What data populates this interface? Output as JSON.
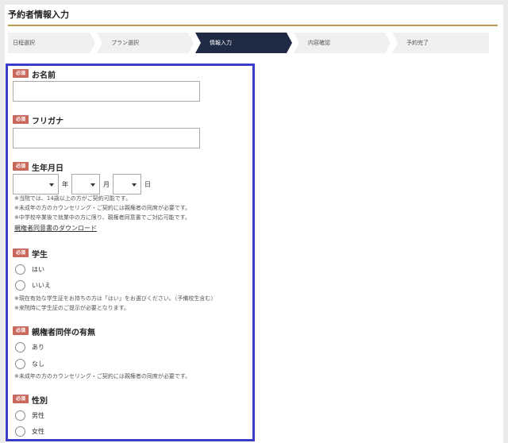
{
  "page": {
    "title": "予約者情報入力"
  },
  "steps": [
    {
      "label": "日程選択"
    },
    {
      "label": "プラン選択"
    },
    {
      "label": "情報入力"
    },
    {
      "label": "内容確認"
    },
    {
      "label": "予約完了"
    }
  ],
  "form": {
    "required_badge": "必須",
    "name": {
      "label": "お名前",
      "value": ""
    },
    "furigana": {
      "label": "フリガナ",
      "value": ""
    },
    "birth": {
      "label": "生年月日",
      "year_unit": "年",
      "month_unit": "月",
      "day_unit": "日",
      "year_value": "",
      "month_value": "",
      "day_value": "",
      "notes": [
        "※当院では、14歳以上の方がご契約可能です。",
        "※未成年の方のカウンセリング・ご契約には親権者の同席が必要です。",
        "※中学校卒業後で就業中の方に限り、親権者同意書でご対応可能です。"
      ],
      "consent_link": "親権者同意書のダウンロード"
    },
    "student": {
      "label": "学生",
      "options": [
        "はい",
        "いいえ"
      ],
      "notes": [
        "※現在有効な学生証をお持ちの方は「はい」をお選びください。（予備校生含む）",
        "※来院時に学生証のご提示が必要となります。"
      ]
    },
    "guardian": {
      "label": "親権者同伴の有無",
      "options": [
        "あり",
        "なし"
      ],
      "notes": [
        "※未成年の方のカウンセリング・ご契約には親権者の同席が必要です。"
      ]
    },
    "gender": {
      "label": "性別",
      "options": [
        "男性",
        "女性"
      ]
    }
  },
  "colors": {
    "required_badge": "#c9685c",
    "active_step": "#1f2a44",
    "title_rule": "#b89a4c",
    "highlight_border": "#3c3cc8"
  }
}
